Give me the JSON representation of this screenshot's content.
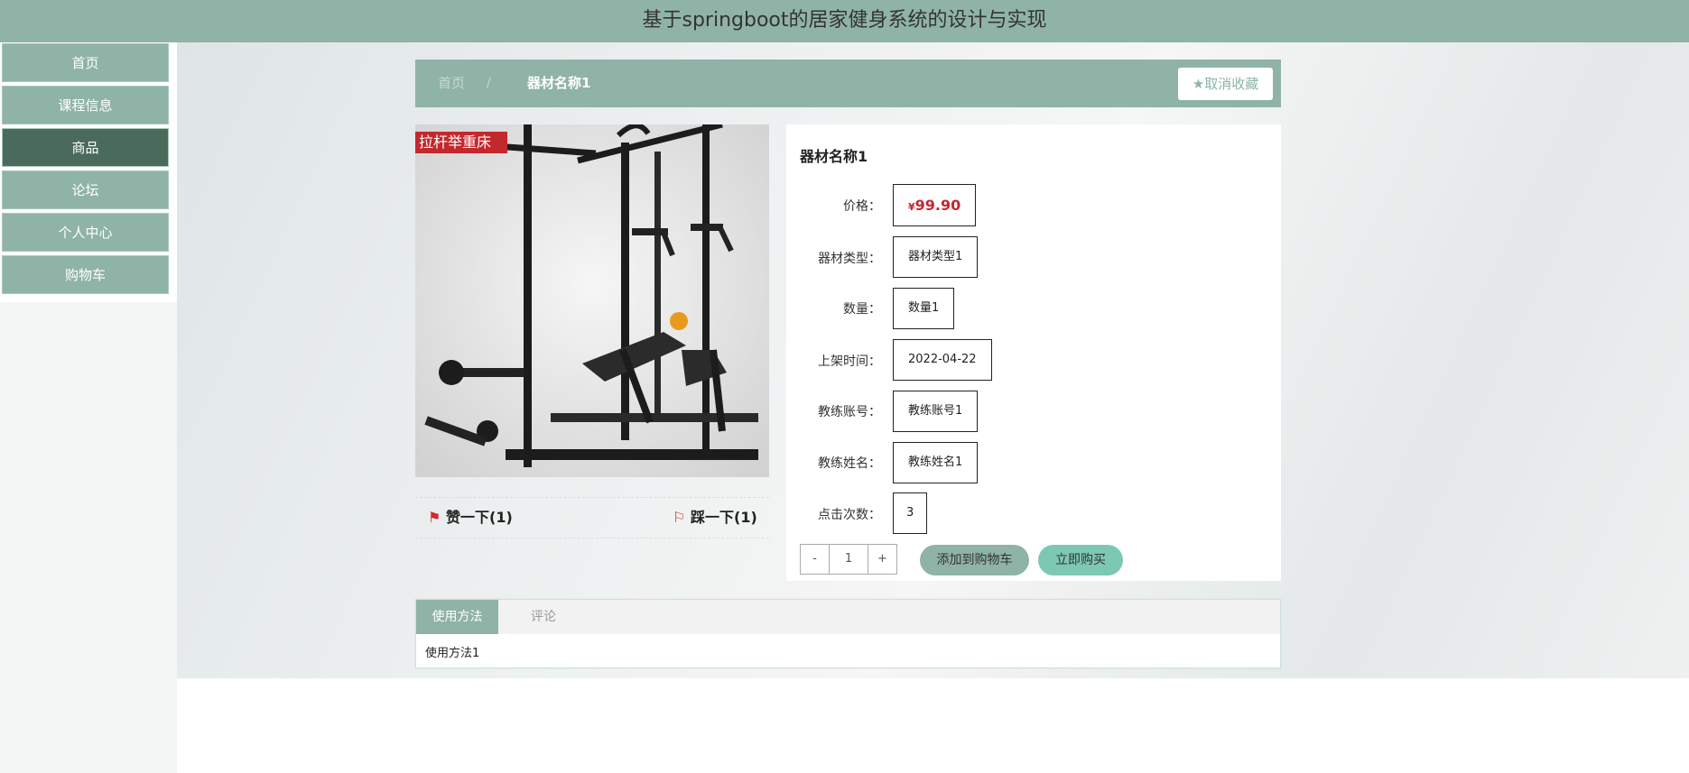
{
  "header": {
    "title": "基于springboot的居家健身系统的设计与实现"
  },
  "sidebar": {
    "items": [
      {
        "label": "首页"
      },
      {
        "label": "课程信息"
      },
      {
        "label": "商品",
        "active": true
      },
      {
        "label": "论坛"
      },
      {
        "label": "个人中心"
      },
      {
        "label": "购物车"
      }
    ]
  },
  "breadcrumb": {
    "home": "首页",
    "separator": "/",
    "current": "器材名称1"
  },
  "favorite": {
    "icon": "star-icon",
    "label": "取消收藏"
  },
  "product": {
    "image_tag": "拉杆举重床",
    "title": "器材名称1",
    "fields": [
      {
        "label": "价格：",
        "currency": "¥",
        "value": "99.90"
      },
      {
        "label": "器材类型：",
        "value": "器材类型1"
      },
      {
        "label": "数量：",
        "value": "数量1"
      },
      {
        "label": "上架时间：",
        "value": "2022-04-22"
      },
      {
        "label": "教练账号：",
        "value": "教练账号1"
      },
      {
        "label": "教练姓名：",
        "value": "教练姓名1"
      },
      {
        "label": "点击次数：",
        "value": "3"
      }
    ]
  },
  "votes": {
    "like_label": "赞一下(1)",
    "dislike_label": "踩一下(1)"
  },
  "quantity": {
    "minus": "-",
    "value": "1",
    "plus": "+"
  },
  "actions": {
    "add_to_cart": "添加到购物车",
    "buy_now": "立即购买"
  },
  "tabs": [
    {
      "label": "使用方法",
      "active": true
    },
    {
      "label": "评论",
      "active": false
    }
  ],
  "tab_content": "使用方法1",
  "colors": {
    "theme": "#8fb3a7",
    "active_nav": "#4a6b5c",
    "price": "#c3282e",
    "buy_now": "#7cc8b2"
  }
}
